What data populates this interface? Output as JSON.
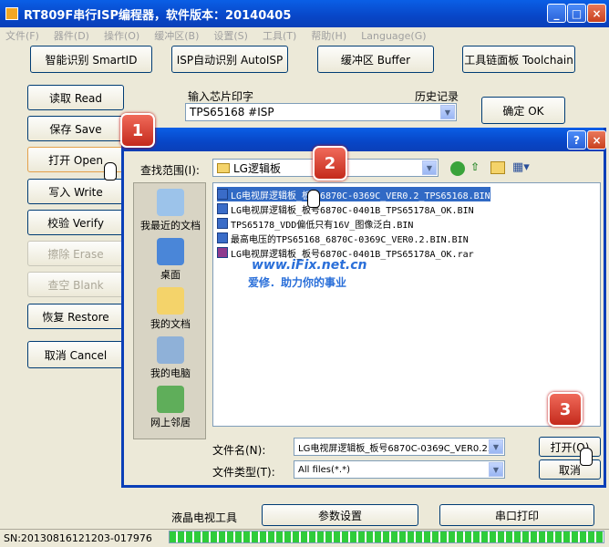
{
  "window": {
    "title": "RT809F串行ISP编程器，软件版本：20140405"
  },
  "menu": [
    "文件(F)",
    "器件(D)",
    "操作(O)",
    "缓冲区(B)",
    "设置(S)",
    "工具(T)",
    "帮助(H)",
    "Language(G)"
  ],
  "top_buttons": {
    "smart_id": "智能识别 SmartID",
    "isp_auto": "ISP自动识别 AutoISP",
    "buffer": "缓冲区 Buffer",
    "toolchain": "工具链面板 Toolchain"
  },
  "left_buttons": {
    "read": "读取 Read",
    "save": "保存 Save",
    "open": "打开 Open",
    "write": "写入 Write",
    "verify": "校验 Verify",
    "erase": "擦除 Erase",
    "blank": "查空 Blank",
    "restore": "恢复 Restore",
    "cancel": "取消 Cancel"
  },
  "chip": {
    "label": "输入芯片印字",
    "history_label": "历史记录",
    "value": "TPS65168 #ISP",
    "confirm": "确定 OK"
  },
  "bottom": {
    "lcd_tools": "液晶电视工具",
    "params": "参数设置",
    "serial_print": "串口打印",
    "serial_no": "SN:20130816121203-017976"
  },
  "dialog": {
    "help": "?",
    "close": "×",
    "look_in_label": "查找范围(I):",
    "look_in_value": "LG逻辑板",
    "places": [
      "我最近的文档",
      "桌面",
      "我的文档",
      "我的电脑",
      "网上邻居"
    ],
    "files": [
      "LG电视屏逻辑板_板号6870C-0369C_VER0.2_TPS65168.BIN",
      "LG电视屏逻辑板_板号6870C-0401B_TPS65178A_OK.BIN",
      "TPS65178_VDD偏低只有16V_图像泛白.BIN",
      "最高电压的TPS65168_6870C-0369C_VER0.2.BIN.BIN",
      "LG电视屏逻辑板_板号6870C-0401B_TPS65178A_OK.rar"
    ],
    "watermark_url": "www.iFix.net.cn",
    "watermark_slogan": "爱修．助力你的事业",
    "filename_label": "文件名(N):",
    "filename_value": "LG电视屏逻辑板_板号6870C-0369C_VER0.2.",
    "filetype_label": "文件类型(T):",
    "filetype_value": "All files(*.*)",
    "open_button": "打开(O)",
    "cancel_button": "取消"
  },
  "callouts": [
    "1",
    "2",
    "3"
  ]
}
